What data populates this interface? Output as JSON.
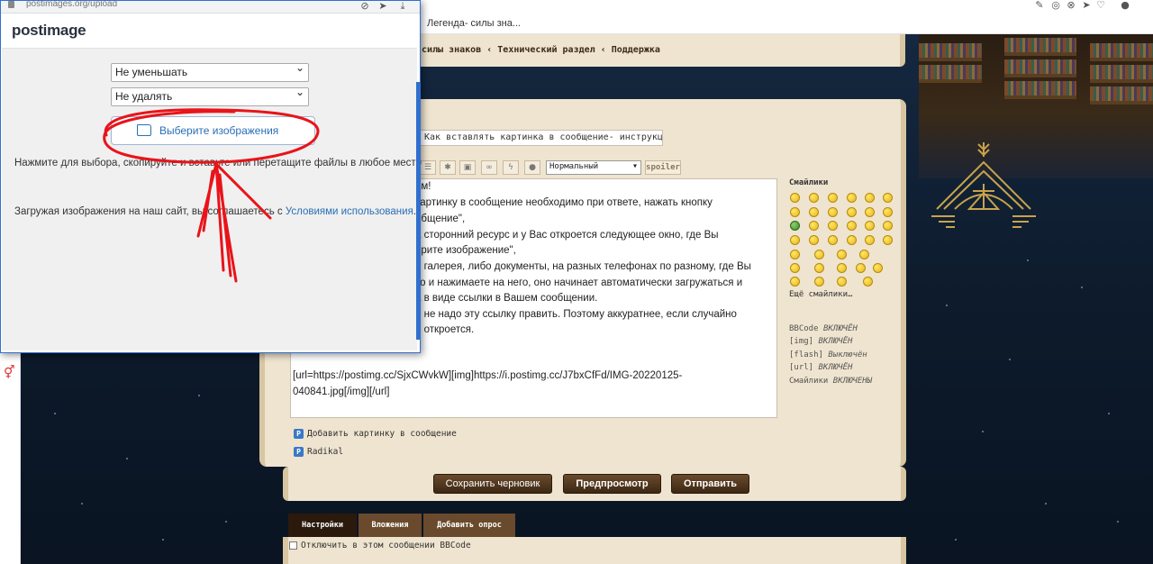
{
  "browser": {
    "popup_url": "postimages.org/upload",
    "tab_title": "Легенда- силы зна..."
  },
  "breadcrumb": "силы знаков ‹ Технический раздел ‹ Поддержка",
  "editor": {
    "subject": "Как вставлять картинка в сообщение- инструкци",
    "font_size_select": "Нормальный",
    "spoiler_label": "spoiler",
    "text_lines": [
      "ем!",
      "картинку в сообщение необходимо при ответе, нажать кнопку",
      "общение\",",
      "а сторонний ресурс и у Вас откроется следующее окно, где Вы",
      "ерите изображение\",",
      "о галерея, либо документы, на разных телефонах по разному, где Вы",
      "то и нажимаете на него, оно начинает автоматически загружаться и",
      "а в виде ссылки в Вашем сообщении.",
      "и не надо эту ссылку править. Поэтому аккуратнее, если случайно",
      "е откроется."
    ],
    "url_line_1": "[url=https://postimg.cc/SjxCWvkW][img]https://i.postimg.cc/J7bxCfFd/IMG-20220125-",
    "url_line_2": "040841.jpg[/img][/url]"
  },
  "smileys": {
    "title": "Смайлики",
    "more_label": "Ещё смайлики…"
  },
  "status": [
    {
      "label": "BBCode",
      "value": "ВКЛЮЧЁН"
    },
    {
      "label": "[img]",
      "value": "ВКЛЮЧЁН"
    },
    {
      "label": "[flash]",
      "value": "Выключён"
    },
    {
      "label": "[url]",
      "value": "ВКЛЮЧЁН"
    },
    {
      "label": "Смайлики",
      "value": "ВКЛЮЧЕНЫ"
    }
  ],
  "plugins": {
    "add_image": "Добавить картинку в сообщение",
    "radikal": "Radikal"
  },
  "buttons": {
    "save_draft": "Сохранить черновик",
    "preview": "Предпросмотр",
    "send": "Отправить"
  },
  "tabs": [
    "Настройки",
    "Вложения",
    "Добавить опрос"
  ],
  "options": {
    "disable_bbcode": "Отключить в этом сообщении BBCode"
  },
  "postimage": {
    "logo": "postimage",
    "resize_select": "Не уменьшать",
    "expire_select": "Не удалять",
    "choose_button": "Выберите изображения",
    "hint": "Нажмите для выбора, скопируйте и вставьте или перетащите файлы в любое место",
    "terms_prefix": "Загружая изображения на наш сайт, вы соглашаетесь с ",
    "terms_link": "Условиями использования",
    "terms_suffix": "."
  },
  "colors": {
    "parchment": "#efe4cf",
    "button_brown": "#4e3520",
    "annotation_red": "#e8141a",
    "link_blue": "#2a6fb5"
  }
}
